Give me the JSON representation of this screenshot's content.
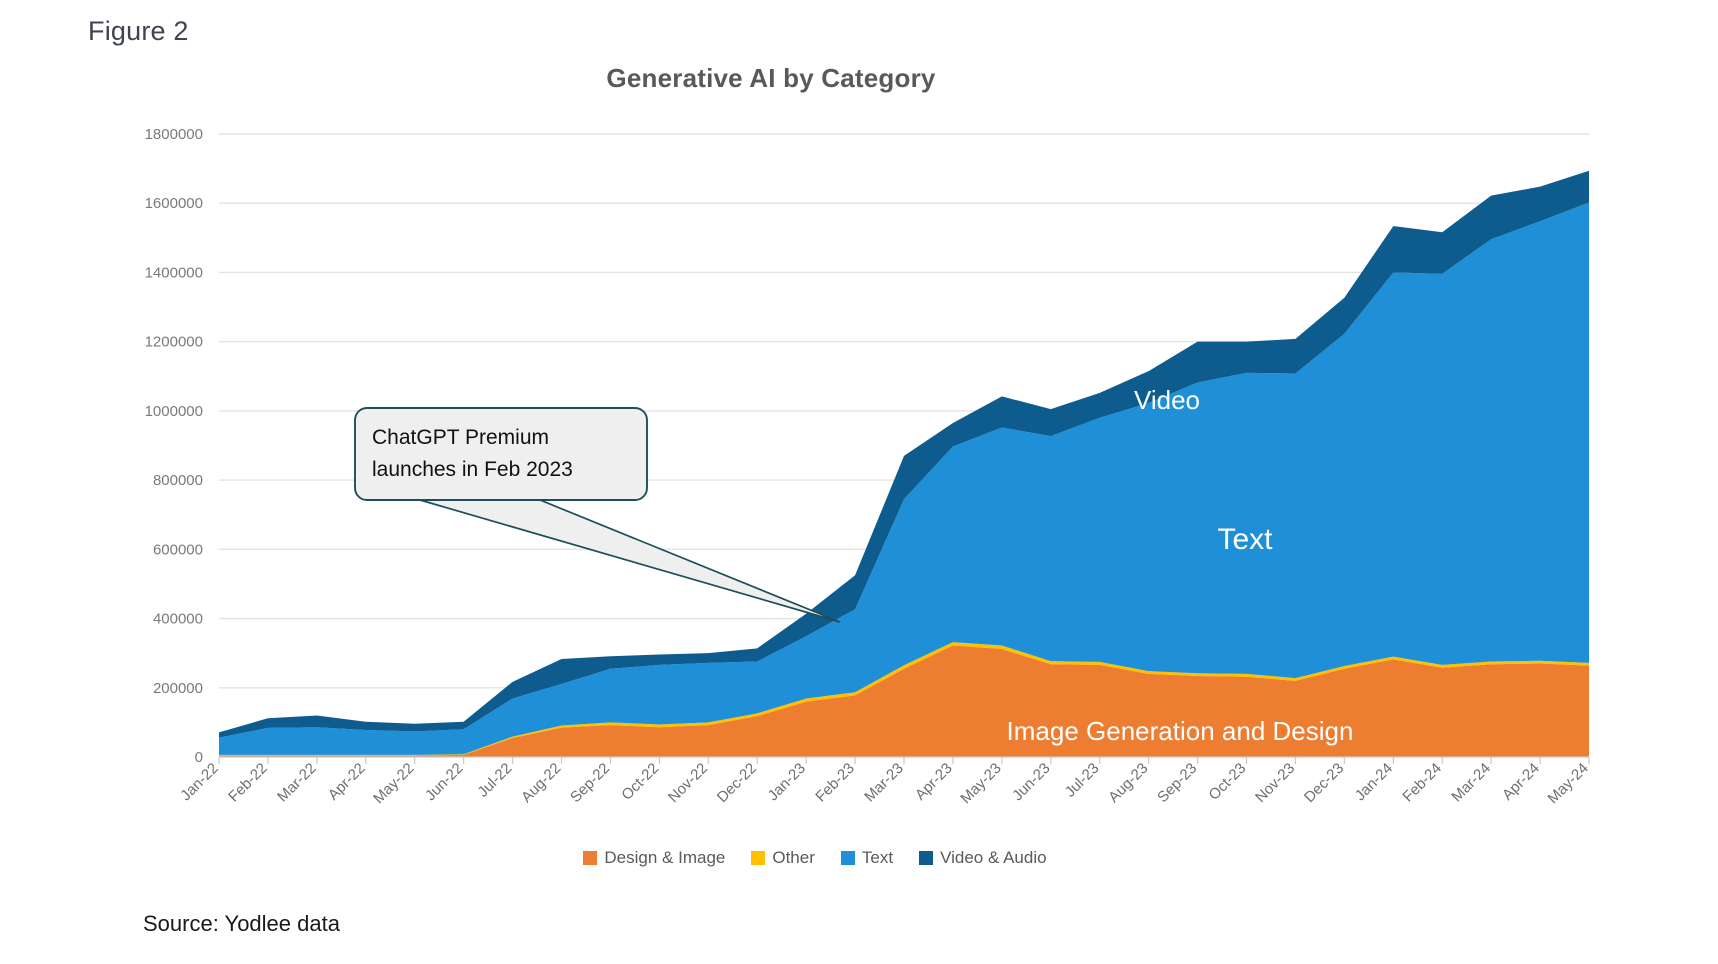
{
  "figure": {
    "label": "Figure 2",
    "title": "Generative AI by Category",
    "source": "Source: Yodlee data"
  },
  "colors": {
    "design_image": "#ED7D31",
    "other": "#FFC000",
    "text": "#1F8FD8",
    "video_audio": "#0E5C8E",
    "gridline": "#E3E3E3",
    "axis_text": "#757575",
    "title": "#595959",
    "callout_border": "#1F4E5A",
    "callout_fill": "#EFEFEF"
  },
  "legend": {
    "position": "bottom-center",
    "items": [
      {
        "label": "Design & Image",
        "color": "#ED7D31"
      },
      {
        "label": "Other",
        "color": "#FFC000"
      },
      {
        "label": "Text",
        "color": "#1F8FD8"
      },
      {
        "label": "Video & Audio",
        "color": "#0E5C8E"
      }
    ]
  },
  "annotations": [
    {
      "name": "chatgpt-premium-callout",
      "line1": "ChatGPT Premium",
      "line2": "launches in Feb 2023",
      "points_to": "Feb-23"
    }
  ],
  "inline_labels": [
    {
      "name": "video-area-label",
      "text": "Video",
      "size": 26
    },
    {
      "name": "text-area-label",
      "text": "Text",
      "size": 30
    },
    {
      "name": "image-area-label",
      "text": "Image Generation and Design",
      "size": 26
    }
  ],
  "chart_data": {
    "type": "area",
    "stacked": true,
    "title": "Generative AI by Category",
    "xlabel": "",
    "ylabel": "",
    "ylim": [
      0,
      1800000
    ],
    "ytick_step": 200000,
    "yticks": [
      0,
      200000,
      400000,
      600000,
      800000,
      1000000,
      1200000,
      1400000,
      1600000,
      1800000
    ],
    "grid": true,
    "legend_position": "bottom",
    "categories": [
      "Jan-22",
      "Feb-22",
      "Mar-22",
      "Apr-22",
      "May-22",
      "Jun-22",
      "Jul-22",
      "Aug-22",
      "Sep-22",
      "Oct-22",
      "Nov-22",
      "Dec-22",
      "Jan-23",
      "Feb-23",
      "Mar-23",
      "Apr-23",
      "May-23",
      "Jun-23",
      "Jul-23",
      "Aug-23",
      "Sep-23",
      "Oct-23",
      "Nov-23",
      "Dec-23",
      "Jan-24",
      "Feb-24",
      "Mar-24",
      "Apr-24",
      "May-24"
    ],
    "series": [
      {
        "name": "Design & Image",
        "color": "#ED7D31",
        "values": [
          4000,
          4000,
          4000,
          4000,
          4000,
          6000,
          55000,
          85000,
          92000,
          86000,
          92000,
          118000,
          160000,
          178000,
          255000,
          322000,
          312000,
          268000,
          266000,
          240000,
          234000,
          232000,
          220000,
          255000,
          282000,
          258000,
          268000,
          270000,
          264000
        ]
      },
      {
        "name": "Other",
        "color": "#FFC000",
        "values": [
          2000,
          2000,
          2000,
          2000,
          2000,
          2000,
          4000,
          6000,
          8000,
          8000,
          8000,
          8000,
          9000,
          9000,
          10000,
          10000,
          10000,
          9000,
          9000,
          8000,
          8000,
          8000,
          8000,
          8000,
          8000,
          8000,
          8000,
          8000,
          8000
        ]
      },
      {
        "name": "Text",
        "color": "#1F8FD8",
        "values": [
          50000,
          78000,
          80000,
          72000,
          68000,
          72000,
          110000,
          120000,
          155000,
          172000,
          172000,
          150000,
          180000,
          240000,
          480000,
          565000,
          630000,
          650000,
          705000,
          775000,
          840000,
          870000,
          880000,
          960000,
          1110000,
          1130000,
          1220000,
          1270000,
          1330000
        ]
      },
      {
        "name": "Video & Audio",
        "color": "#0E5C8E",
        "values": [
          15000,
          28000,
          34000,
          24000,
          22000,
          22000,
          48000,
          72000,
          36000,
          30000,
          28000,
          38000,
          65000,
          98000,
          125000,
          68000,
          90000,
          78000,
          72000,
          92000,
          118000,
          90000,
          100000,
          104000,
          134000,
          120000,
          126000,
          100000,
          92000
        ]
      }
    ]
  }
}
